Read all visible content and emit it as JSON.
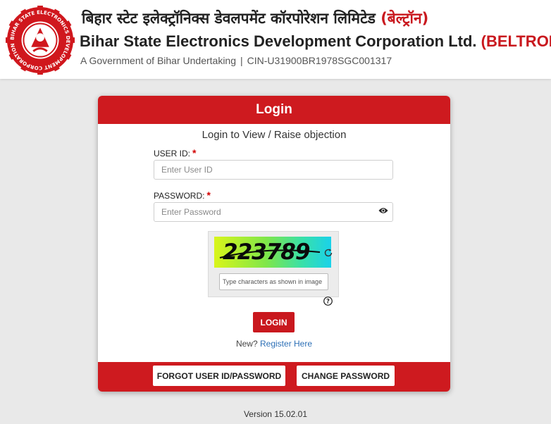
{
  "header": {
    "title_hindi": "बिहार स्टेट इलेक्ट्रॉनिक्स डेवलपमेंट कॉरपोरेशन लिमिटेड",
    "title_hindi_short": "(बेल्ट्रॉन)",
    "title_english": "Bihar State Electronics Development Corporation Ltd.",
    "title_english_short": "(BELTRON)",
    "undertaking": "A Government of Bihar Undertaking",
    "separator": "|",
    "cin": "CIN-U31900BR1978SGC001317",
    "logo_ring_text": "BIHAR STATE ELECTRONICS DEVELOPMENT CORPORATION LIMITED"
  },
  "login": {
    "heading": "Login",
    "subheading": "Login to View / Raise objection",
    "user_label": "USER ID:",
    "user_placeholder": "Enter User ID",
    "user_value": "",
    "password_label": "PASSWORD:",
    "password_placeholder": "Enter Password",
    "password_value": "",
    "required_mark": "*",
    "captcha_text": "223789",
    "captcha_placeholder": "Type characters as shown in image",
    "captcha_value": "",
    "login_button": "LOGIN",
    "new_text": "New?",
    "register_link": "Register Here",
    "forgot_button": "FORGOT USER ID/PASSWORD",
    "change_button": "CHANGE PASSWORD"
  },
  "footer": {
    "version": "Version 15.02.01"
  },
  "colors": {
    "brand_red": "#ce1a1f",
    "link_blue": "#2c6fb6",
    "background": "#e9e9e9"
  },
  "icons": {
    "eye": "eye-icon",
    "refresh": "refresh-icon",
    "help": "help-icon"
  }
}
